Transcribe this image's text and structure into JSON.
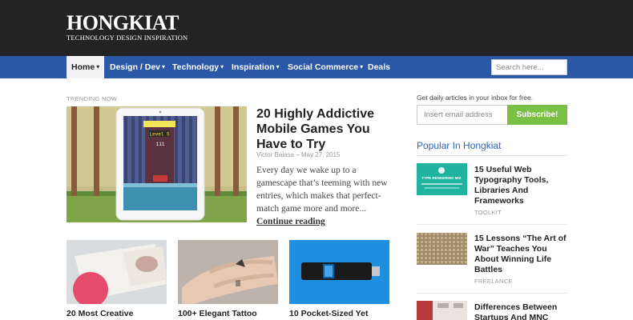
{
  "header": {
    "logo_text": "HONGKIAT",
    "logo_tagline": "TECHNOLOGY DESIGN INSPIRATION"
  },
  "nav": {
    "items": [
      {
        "label": "Home",
        "dropdown": true,
        "active": true
      },
      {
        "label": "Design / Dev",
        "dropdown": true
      },
      {
        "label": "Technology",
        "dropdown": true
      },
      {
        "label": "Inspiration",
        "dropdown": true
      },
      {
        "label": "Social Commerce",
        "dropdown": true
      },
      {
        "label": "Deals",
        "dropdown": false
      }
    ],
    "search_placeholder": "Search here..."
  },
  "trending": {
    "label": "TRENDING NOW",
    "title": "20 Highly Addictive Mobile Games You Have to Try",
    "author": "Victor Balasa",
    "separator": "–",
    "date": "May 27, 2015",
    "excerpt": "Every day we wake up to a gamescape that’s teeming with new entries, which makes that perfect-match game more and more...",
    "continue_label": "Continue reading",
    "game_level_text": "Level 5",
    "game_score": "111"
  },
  "cards": [
    {
      "title": "20 Most Creative"
    },
    {
      "title": "100+ Elegant Tattoo"
    },
    {
      "title": "10 Pocket-Sized Yet"
    }
  ],
  "sidebar": {
    "newsletter_label": "Get daily articles in your inbox for free.",
    "email_placeholder": "Insert email address",
    "subscribe_label": "Subscribe!",
    "popular_heading": "Popular In Hongkiat",
    "popular": [
      {
        "title": "15 Useful Web Typography Tools, Libraries And Frameworks",
        "category": "TOOLKIT",
        "thumb_text": "TYPE RENDERING MIX"
      },
      {
        "title": "15 Lessons “The Art of War” Teaches You About Winning Life Battles",
        "category": "FREELANCE"
      },
      {
        "title": "Differences Between Startups And MNC",
        "category": ""
      }
    ]
  },
  "colors": {
    "header_bg": "#232323",
    "nav_bg": "#2b58a6",
    "accent_link": "#2f65b1",
    "subscribe_bg": "#7ac143"
  }
}
